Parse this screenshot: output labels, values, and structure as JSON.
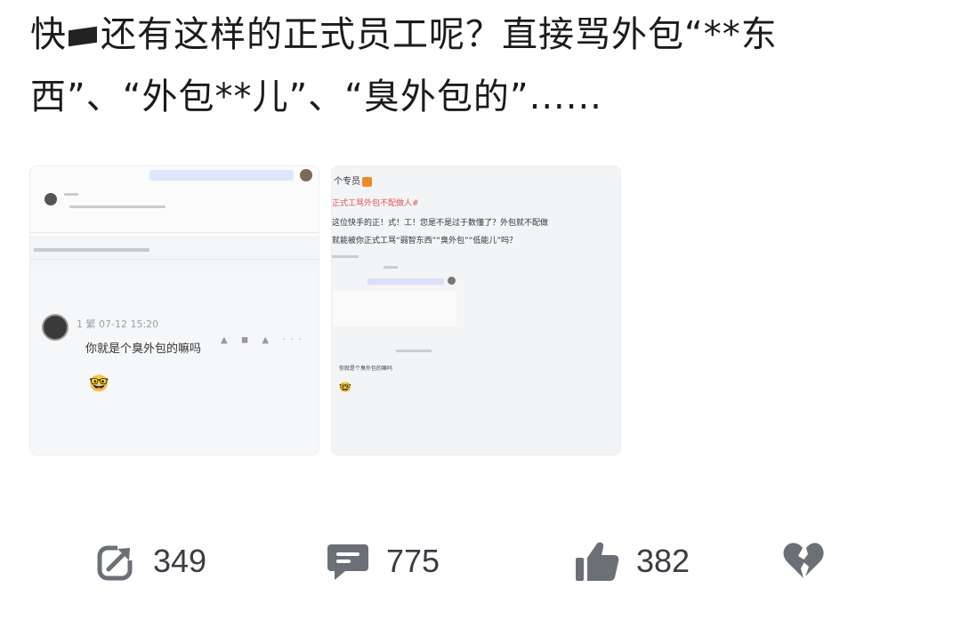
{
  "post": {
    "text_part1": "快",
    "text_part2": "还有这样的正式员工呢？直接骂外包“**东西”、“外包**儿”、“臭外包的”......"
  },
  "thumb1": {
    "commenter_name": "1 繁 07-12 15:20",
    "comment": "你就是个臭外包的嘛吗",
    "emoji": "🤓"
  },
  "thumb2": {
    "header": "个专员",
    "red_line": "正式工骂外包不配做人#",
    "body_line1": "这位快手的正！式！工！您是不是过于数懂了？外包就不配做",
    "body_line2": "就能被你正式工骂“弱智东西”“臭外包”“低能儿”吗？",
    "comment": "你就是个臭外包的嘛吗",
    "emoji": "🤓"
  },
  "actions": {
    "share_count": "349",
    "comment_count": "775",
    "like_count": "382"
  },
  "colors": {
    "icon": "#6b6f76",
    "text": "#1b1b1b"
  }
}
